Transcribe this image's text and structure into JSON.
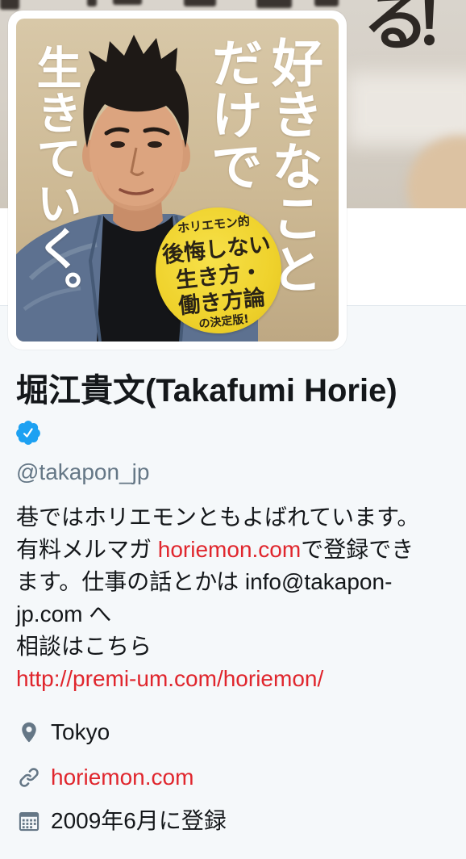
{
  "banner": {
    "text": "る！"
  },
  "avatar": {
    "title": [
      "好きなこと",
      "だけで",
      "生きていく。"
    ],
    "badge": {
      "top": "ホリエモン的",
      "lines": [
        "後悔しない",
        "生き方・",
        "働き方論"
      ],
      "bottom": "の決定版!"
    }
  },
  "profile": {
    "name": "堀江貴文(Takafumi Horie)",
    "handle": "@takapon_jp",
    "bio": {
      "line1": "巷ではホリエモンともよばれています。",
      "line2_text": "有料メルマガ ",
      "line2_link": "horiemon.com",
      "line2_rest": "で登録でき",
      "line3": "ます。仕事の話とかは info@takapon-",
      "line4": "jp.com へ",
      "line5": "相談はこちら",
      "line6_link": "http://premi-um.com/horiemon/"
    },
    "location": "Tokyo",
    "website": "horiemon.com",
    "joined": "2009年6月に登録"
  },
  "icons": {
    "verified": "verified-badge-icon",
    "location": "location-pin-icon",
    "website": "link-icon",
    "joined": "calendar-icon"
  },
  "colors": {
    "link": "#e0262d",
    "verified": "#1da1f2",
    "text": "#14171a",
    "secondary_text": "#657786",
    "page_background": "#f5f8fa"
  }
}
